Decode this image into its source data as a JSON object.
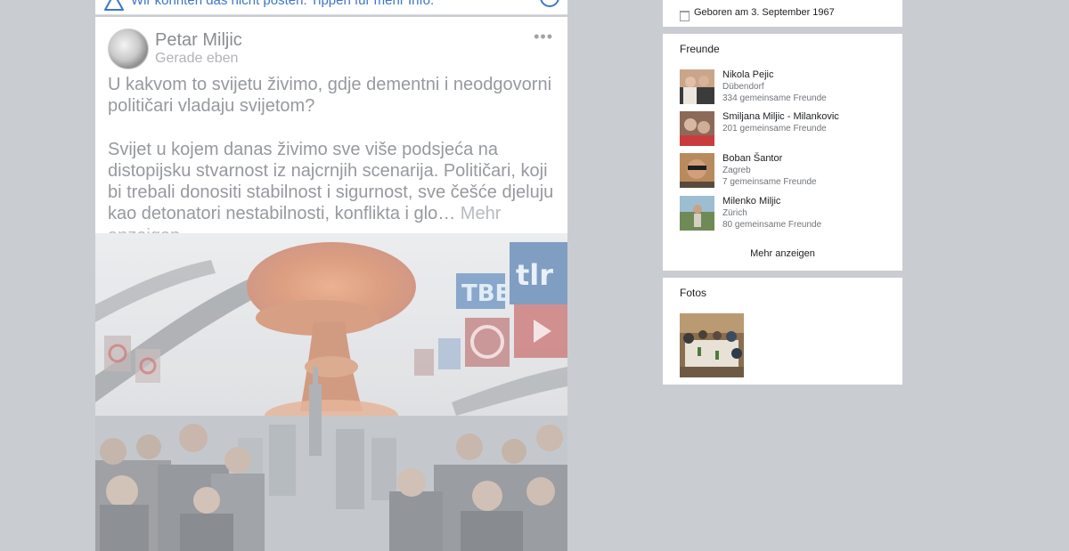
{
  "banner": {
    "text": "Wir konnten das nicht posten. Tippen für mehr Info.",
    "warning_icon": "warning-icon",
    "info_icon": "info-icon"
  },
  "post": {
    "author": "Petar Miljic",
    "time": "Gerade eben",
    "more_icon": "•••",
    "paragraph1": "U kakvom to svijetu živimo, gdje dementni i neodgovorni političari vladaju svijetom?",
    "paragraph2": "Svijet u kojem danas živimo sve više podsjeća na distopijsku stvarnost iz najcrnjih scenarija. Političari, koji bi trebali donositi stabilnost i sigurnost, sve češće djeluju kao detonatori nestabilnosti, konflikta i glo…",
    "mehr_link": "Mehr anzeigen",
    "image_signs": [
      "TBE",
      "tlr"
    ]
  },
  "sidebar": {
    "birthday": "Geboren am 3. September 1967",
    "friends_title": "Freunde",
    "friends": [
      {
        "name": "Nikola Pejic",
        "location": "Dübendorf",
        "mutual": "334 gemeinsame Freunde"
      },
      {
        "name": "Smiljana Miljic - Milankovic",
        "location": "",
        "mutual": "201 gemeinsame Freunde"
      },
      {
        "name": "Boban Šantor",
        "location": "Zagreb",
        "mutual": "7 gemeinsame Freunde"
      },
      {
        "name": "Milenko Miljic",
        "location": "Zürich",
        "mutual": "80 gemeinsame Freunde"
      }
    ],
    "mehr_button": "Mehr anzeigen",
    "fotos_title": "Fotos"
  },
  "colors": {
    "page_bg": "#c9cdd2",
    "link_blue": "#3b76c9",
    "muted_text": "#96999e"
  }
}
